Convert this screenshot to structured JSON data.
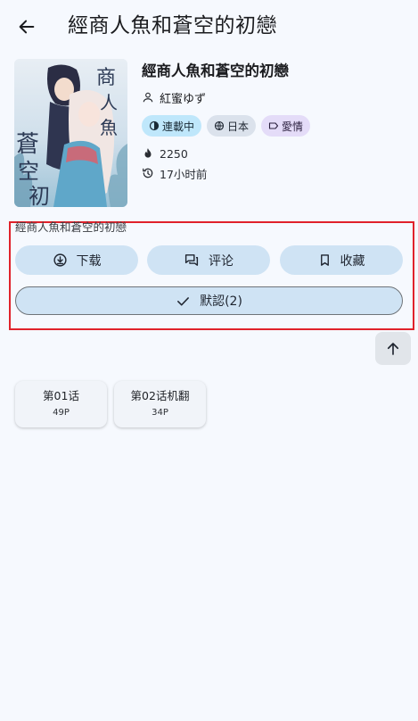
{
  "app_bar": {
    "title": "經商人魚和蒼空的初戀",
    "back_icon": "arrow-left-icon"
  },
  "comic": {
    "title": "經商人魚和蒼空的初戀",
    "author": "紅蜜ゆず",
    "tags": [
      {
        "label": "連載中",
        "icon": "progress-icon",
        "color": "#bfe7fb"
      },
      {
        "label": "日本",
        "icon": "globe-icon",
        "color": "#dbe2ec"
      },
      {
        "label": "愛情",
        "icon": "label-icon",
        "color": "#e4dcf8"
      }
    ],
    "popularity": "2250",
    "updated": "17小时前"
  },
  "actions": {
    "section_label": "經商人魚和蒼空的初戀",
    "download": "下载",
    "comment": "评论",
    "favorite": "收藏",
    "default_group": "默認(2)"
  },
  "chapters": [
    {
      "title": "第01话",
      "pages": "49P"
    },
    {
      "title": "第02话机翻",
      "pages": "34P"
    }
  ],
  "colors": {
    "background": "#f6f9fe",
    "button": "#cfe3f4",
    "highlight_frame": "#e0222b"
  }
}
